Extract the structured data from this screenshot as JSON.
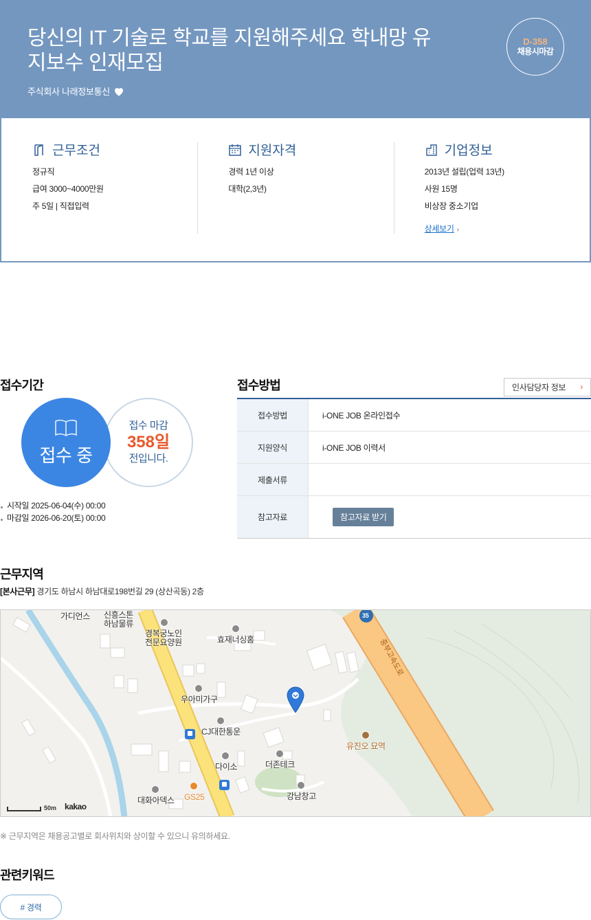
{
  "header": {
    "title": "당신의 IT 기술로 학교를 지원해주세요 학내망 유지보수 인재모집",
    "company": "주식회사 나래정보통신",
    "dday": "D-358",
    "dday_label": "채용시마감"
  },
  "summary": {
    "work_conditions": {
      "title": "근무조건",
      "items": [
        "정규직",
        "급여 3000~4000만원",
        "주 5일 | 직접입력"
      ]
    },
    "qualifications": {
      "title": "지원자격",
      "items": [
        "경력 1년 이상",
        "대학(2,3년)"
      ]
    },
    "company_info": {
      "title": "기업정보",
      "items": [
        "2013년 설립(업력 13년)",
        "사원 15명",
        "비상장 중소기업"
      ],
      "more_link": "상세보기"
    }
  },
  "period": {
    "title": "접수기간",
    "status": "접수 중",
    "deadline_line1": "접수 마감",
    "days_left": "358일",
    "deadline_line2": "전입니다.",
    "start": "시작일 2025-06-04(수) 00:00",
    "end": "마감일 2026-06-20(토) 00:00"
  },
  "method": {
    "title": "접수방법",
    "hr_button": "인사담당자 정보",
    "rows": [
      {
        "label": "접수방법",
        "value": "i-ONE JOB 온라인접수"
      },
      {
        "label": "지원양식",
        "value": "i-ONE JOB 이력서"
      },
      {
        "label": "제출서류",
        "value": ""
      },
      {
        "label": "참고자료",
        "value": ""
      }
    ],
    "ref_button": "참고자료 받기"
  },
  "location": {
    "title": "근무지역",
    "tag": "[본사근무]",
    "address": "경기도 하남시 하남대로198번길 29 (상산곡동) 2층",
    "map_labels": {
      "l1": "가디언스",
      "l2": "신흥스톤",
      "l2b": "하남물류",
      "l3": "경복궁노인",
      "l3b": "전문요양원",
      "l4": "효재너싱홈",
      "l5": "우아미가구",
      "l6": "CJ대한통운",
      "l7": "다이소",
      "l8": "더존테크",
      "l9": "유진오 묘역",
      "l10": "대화아덱스",
      "l11": "GS25",
      "l12": "강남창고",
      "highway": "중부고속도로",
      "route": "35"
    },
    "scale": "50m",
    "map_brand": "kakao",
    "note": "※ 근무지역은 채용공고별로 회사위치와 상이할 수 있으니 유의하세요."
  },
  "keywords": {
    "title": "관련키워드",
    "items": [
      "# 경력"
    ]
  },
  "colors": {
    "header_bg": "#7497c0",
    "accent_blue": "#3c86e3",
    "accent_orange": "#e8592b",
    "navy": "#2f5f97"
  }
}
